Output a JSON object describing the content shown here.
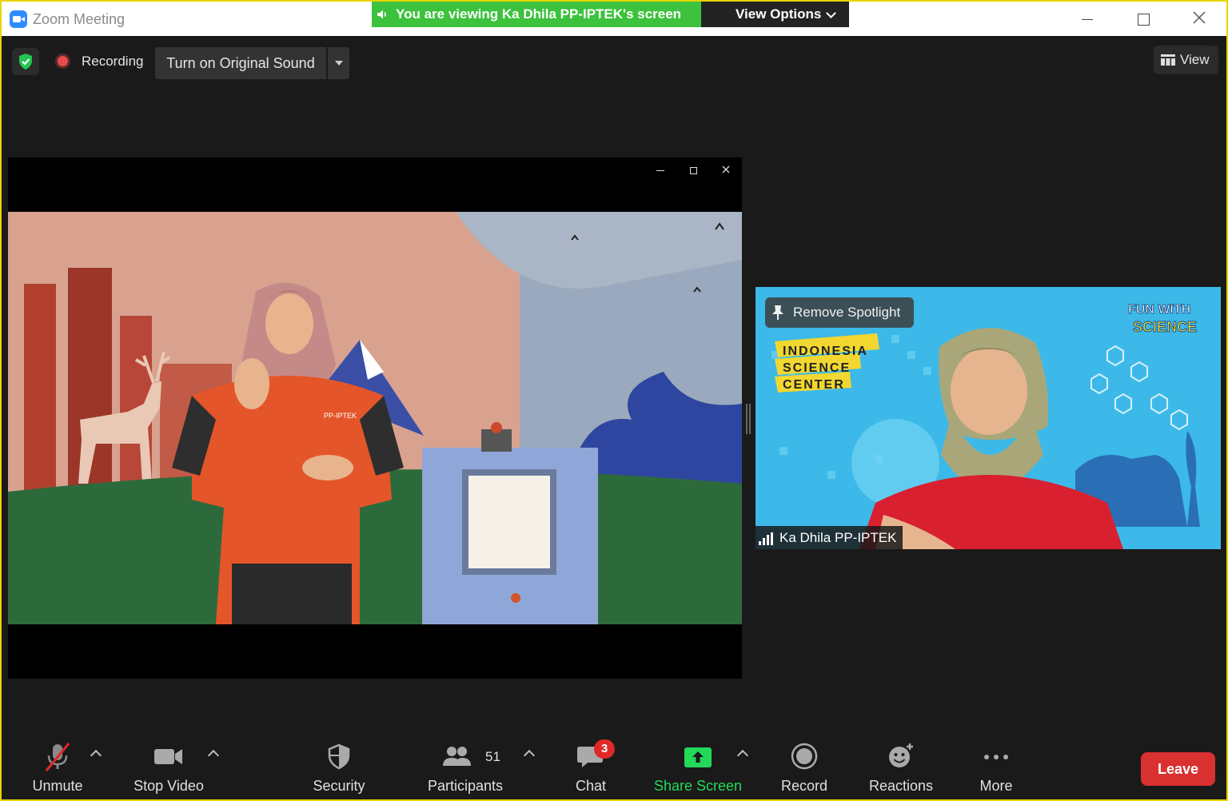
{
  "window": {
    "title": "Zoom Meeting"
  },
  "banner": {
    "viewing": "You are viewing Ka Dhila PP-IPTEK's screen",
    "view_options": "View Options"
  },
  "topbar": {
    "recording": "Recording",
    "original_sound": "Turn on Original Sound",
    "view": "View"
  },
  "share_window": {
    "poster_brand": "PP-IPTEK"
  },
  "participant": {
    "spotlight_button": "Remove Spotlight",
    "name": "Ka Dhila PP-IPTEK",
    "logo_lines": [
      "INDONESIA",
      "SCIENCE",
      "CENTER"
    ],
    "fun_line1": "FUN WITH",
    "fun_line2": "SCIENCE"
  },
  "toolbar": {
    "unmute": "Unmute",
    "stop_video": "Stop Video",
    "security": "Security",
    "participants": "Participants",
    "participants_count": "51",
    "chat": "Chat",
    "chat_badge": "3",
    "share_screen": "Share Screen",
    "record": "Record",
    "reactions": "Reactions",
    "more": "More",
    "leave": "Leave"
  },
  "colors": {
    "accent_green": "#3cc23c",
    "share_green": "#23d959",
    "leave_red": "#d93030",
    "frame_yellow": "#e8d400"
  }
}
